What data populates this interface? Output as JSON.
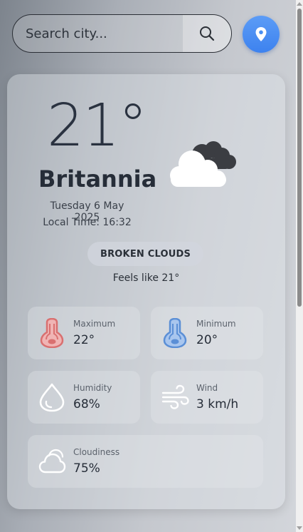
{
  "search": {
    "placeholder": "Search city...",
    "value": "",
    "button_icon": "search-icon"
  },
  "location_button": {
    "icon": "map-pin-icon",
    "color": "#4a8ff2"
  },
  "current": {
    "temperature": "21°",
    "city": "Britannia",
    "date": "Tuesday 6 May 2025",
    "local_time": "Local Time: 16:32",
    "condition_icon": "broken-clouds-icon",
    "description": "BROKEN CLOUDS",
    "feels_like": "Feels like 21°"
  },
  "details": [
    {
      "key": "max",
      "label": "Maximum",
      "value": "22°",
      "icon": "thermometer-hot-icon",
      "color": "#e27a7a"
    },
    {
      "key": "min",
      "label": "Minimum",
      "value": "20°",
      "icon": "thermometer-cold-icon",
      "color": "#5b8fd6"
    },
    {
      "key": "humidity",
      "label": "Humidity",
      "value": "68%",
      "icon": "droplet-icon",
      "color": "#ffffff"
    },
    {
      "key": "wind",
      "label": "Wind",
      "value": "3 km/h",
      "icon": "wind-icon",
      "color": "#ffffff"
    },
    {
      "key": "cloudiness",
      "label": "Cloudiness",
      "value": "75%",
      "icon": "cloud-icon",
      "color": "#ffffff"
    }
  ]
}
